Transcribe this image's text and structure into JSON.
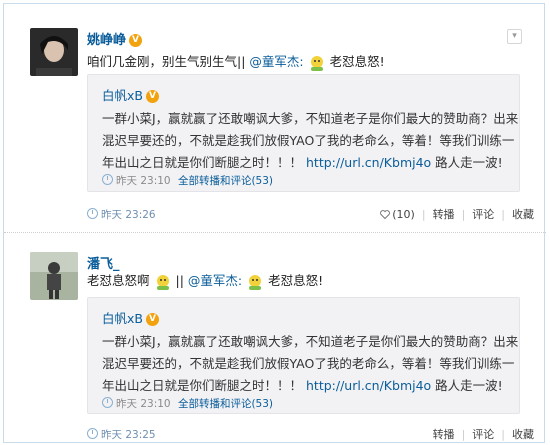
{
  "posts": [
    {
      "user": "姚峥峥",
      "text_before": "咱们几金刚，别生气别生气||",
      "mention": "@童军杰:",
      "text_after": "老怼息怒!",
      "repost": {
        "user": "白帆xB",
        "lines": [
          "一群小菜J，赢就赢了还敢嘲讽大爹，不知道老子是你们最大的赞助商？出来",
          "混迟早要还的，不就是趁我们放假YAO了我的老命么，等着！等我们训练一",
          "年出山之日就是你们断腿之时！！！"
        ],
        "url": "http://url.cn/Kbmj4o",
        "url_suffix": " 路人走一波!",
        "time": "昨天 23:10",
        "comments_link": "全部转播和评论(53)"
      },
      "time": "昨天 23:26",
      "likes": "(10)",
      "actions": [
        "转播",
        "评论",
        "收藏"
      ]
    },
    {
      "user": "潘飞_",
      "text_before": "老怼息怒啊",
      "text_mid": "||",
      "mention": "@童军杰:",
      "text_after": "老怼息怒!",
      "repost": {
        "user": "白帆xB",
        "lines": [
          "一群小菜J，赢就赢了还敢嘲讽大爹，不知道老子是你们最大的赞助商？出来",
          "混迟早要还的，不就是趁我们放假YAO了我的老命么，等着！等我们训练一",
          "年出山之日就是你们断腿之时！！！"
        ],
        "url": "http://url.cn/Kbmj4o",
        "url_suffix": " 路人走一波!",
        "time": "昨天 23:10",
        "comments_link": "全部转播和评论(53)"
      },
      "time": "昨天 23:25",
      "actions": [
        "转播",
        "评论",
        "收藏"
      ]
    }
  ],
  "colors": {
    "link": "#0a5d9a",
    "badge": "#f2a20d",
    "repost_bg": "#f2f2f5"
  }
}
